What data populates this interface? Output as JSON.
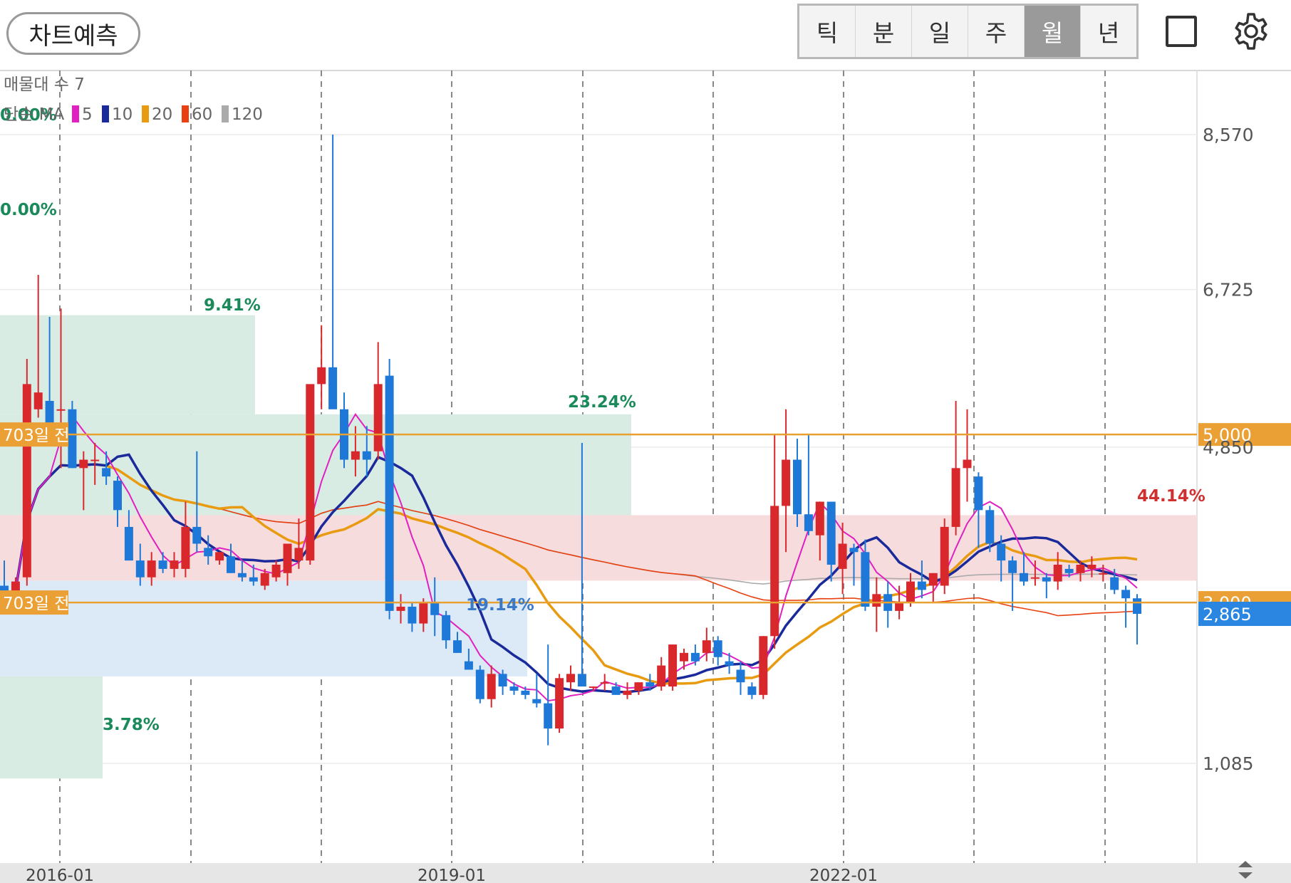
{
  "toolbar": {
    "predict_label": "차트예측",
    "periods": [
      "틱",
      "분",
      "일",
      "주",
      "월",
      "년"
    ],
    "active_period": "월"
  },
  "legend": {
    "volume_profile": "매물대 수 7",
    "ma_title": "단순 MA",
    "ma": [
      {
        "label": "5",
        "color": "#e020c0"
      },
      {
        "label": "10",
        "color": "#1a2a9a"
      },
      {
        "label": "20",
        "color": "#e89a10"
      },
      {
        "label": "60",
        "color": "#e84010"
      },
      {
        "label": "120",
        "color": "#aaaaaa"
      }
    ]
  },
  "chart_data": {
    "type": "candlestick",
    "interval": "monthly",
    "y_ticks": [
      "8,570",
      "6,725",
      "4,850",
      "1,085"
    ],
    "y_range": [
      600,
      9200
    ],
    "x_ticks": [
      "2016-01",
      "2019-01",
      "2022-01"
    ],
    "current_price": "2,865",
    "hlines": [
      {
        "price": 5000,
        "label": "703일 전",
        "value_label": "5,000"
      },
      {
        "price": 3000,
        "label": "703일 전",
        "value_label": "3,000"
      }
    ],
    "volume_profile_pcts": [
      {
        "label": "0.00%",
        "color": "#1a8a5a"
      },
      {
        "label": "0.00%",
        "color": "#1a8a5a"
      },
      {
        "label": "9.41%",
        "color": "#1a8a5a"
      },
      {
        "label": "23.24%",
        "color": "#1a8a5a"
      },
      {
        "label": "44.14%",
        "color": "#d03030"
      },
      {
        "label": "19.14%",
        "color": "#3a7ac8"
      },
      {
        "label": "3.78%",
        "color": "#1a8a5a"
      }
    ],
    "candles": [
      [
        3200,
        3500,
        2900,
        3050
      ],
      [
        3000,
        3300,
        2950,
        3250
      ],
      [
        3300,
        5900,
        3200,
        5600
      ],
      [
        5300,
        6900,
        5200,
        5500
      ],
      [
        5400,
        6400,
        5100,
        5100
      ],
      [
        5300,
        6500,
        4600,
        5300
      ],
      [
        5300,
        5400,
        4600,
        4600
      ],
      [
        4600,
        4800,
        4100,
        4700
      ],
      [
        4700,
        4900,
        4400,
        4700
      ],
      [
        4600,
        4800,
        4400,
        4500
      ],
      [
        4450,
        4500,
        3900,
        4100
      ],
      [
        3900,
        4100,
        3600,
        3500
      ],
      [
        3500,
        3700,
        3200,
        3300
      ],
      [
        3300,
        3600,
        3200,
        3500
      ],
      [
        3500,
        3600,
        3350,
        3400
      ],
      [
        3400,
        3600,
        3300,
        3500
      ],
      [
        3400,
        4200,
        3300,
        3900
      ],
      [
        3900,
        4800,
        3600,
        3700
      ],
      [
        3650,
        3800,
        3450,
        3550
      ],
      [
        3500,
        3600,
        3450,
        3600
      ],
      [
        3550,
        3700,
        3350,
        3350
      ],
      [
        3350,
        3500,
        3250,
        3300
      ],
      [
        3300,
        3450,
        3200,
        3250
      ],
      [
        3200,
        3400,
        3150,
        3350
      ],
      [
        3300,
        3500,
        3250,
        3450
      ],
      [
        3350,
        3650,
        3200,
        3700
      ],
      [
        3500,
        4000,
        3400,
        3650
      ],
      [
        3500,
        4200,
        3450,
        5600
      ],
      [
        5600,
        6300,
        5300,
        5800
      ],
      [
        5800,
        8570,
        5400,
        5300
      ],
      [
        5300,
        5500,
        4600,
        4700
      ],
      [
        4700,
        5100,
        4500,
        4800
      ],
      [
        4800,
        5100,
        4500,
        4700
      ],
      [
        4800,
        6100,
        4700,
        5600
      ],
      [
        5700,
        5900,
        2800,
        2900
      ],
      [
        2900,
        3100,
        2750,
        2950
      ],
      [
        2950,
        3000,
        2650,
        2750
      ],
      [
        2750,
        3050,
        2650,
        3000
      ],
      [
        3000,
        3300,
        2600,
        2850
      ],
      [
        2850,
        2900,
        2450,
        2550
      ],
      [
        2550,
        2650,
        2400,
        2400
      ],
      [
        2300,
        2450,
        2200,
        2200
      ],
      [
        2200,
        2250,
        1800,
        1850
      ],
      [
        1850,
        2250,
        1750,
        2150
      ],
      [
        2150,
        2200,
        1900,
        2000
      ],
      [
        2000,
        2050,
        1900,
        1950
      ],
      [
        1950,
        2000,
        1850,
        1900
      ],
      [
        1850,
        2150,
        1750,
        1800
      ],
      [
        1800,
        2500,
        1300,
        1500
      ],
      [
        1500,
        2150,
        1450,
        2100
      ],
      [
        2050,
        2250,
        1950,
        2150
      ],
      [
        2150,
        4900,
        2000,
        2000
      ],
      [
        2000,
        2000,
        1950,
        2000
      ],
      [
        2050,
        2150,
        1950,
        2050
      ],
      [
        2000,
        2050,
        1950,
        1900
      ],
      [
        1900,
        2050,
        1850,
        1950
      ],
      [
        1950,
        2050,
        1900,
        2050
      ],
      [
        2050,
        2150,
        1950,
        2000
      ],
      [
        2000,
        2350,
        1950,
        2250
      ],
      [
        2000,
        2400,
        1950,
        2500
      ],
      [
        2300,
        2450,
        2200,
        2400
      ],
      [
        2400,
        2500,
        2250,
        2300
      ],
      [
        2400,
        2700,
        2300,
        2550
      ],
      [
        2550,
        2600,
        2250,
        2350
      ],
      [
        2300,
        2400,
        2150,
        2250
      ],
      [
        2200,
        2300,
        1900,
        2050
      ],
      [
        2000,
        2050,
        1850,
        1900
      ],
      [
        1900,
        2600,
        1850,
        2600
      ],
      [
        2600,
        5000,
        2450,
        4150
      ],
      [
        4150,
        5300,
        3600,
        4700
      ],
      [
        4700,
        4950,
        3900,
        4050
      ],
      [
        4050,
        5000,
        3800,
        3850
      ],
      [
        3800,
        4200,
        3500,
        4200
      ],
      [
        4200,
        4200,
        3250,
        3450
      ],
      [
        3400,
        3950,
        3100,
        3700
      ],
      [
        3650,
        3700,
        3200,
        3600
      ],
      [
        3600,
        3750,
        2900,
        2950
      ],
      [
        2950,
        3300,
        2650,
        3100
      ],
      [
        3100,
        3250,
        2700,
        2900
      ],
      [
        2900,
        3200,
        2800,
        3000
      ],
      [
        3000,
        3350,
        2950,
        3250
      ],
      [
        3250,
        3500,
        3050,
        3150
      ],
      [
        3200,
        3350,
        3000,
        3350
      ],
      [
        3200,
        4000,
        3100,
        3900
      ],
      [
        3900,
        5400,
        3800,
        4600
      ],
      [
        4600,
        5300,
        4200,
        4700
      ],
      [
        4500,
        4550,
        3650,
        4100
      ],
      [
        4100,
        4150,
        3600,
        3700
      ],
      [
        3700,
        3800,
        3250,
        3500
      ],
      [
        3500,
        3550,
        2900,
        3350
      ],
      [
        3350,
        3600,
        3200,
        3250
      ],
      [
        3300,
        3500,
        3200,
        3300
      ],
      [
        3300,
        3350,
        3050,
        3250
      ],
      [
        3250,
        3600,
        3150,
        3450
      ],
      [
        3400,
        3450,
        3300,
        3350
      ],
      [
        3350,
        3500,
        3250,
        3450
      ],
      [
        3400,
        3550,
        3300,
        3450
      ],
      [
        3350,
        3450,
        3250,
        3350
      ],
      [
        3300,
        3400,
        3100,
        3150
      ],
      [
        3150,
        3200,
        2700,
        3050
      ],
      [
        3050,
        3100,
        2500,
        2865
      ]
    ]
  }
}
